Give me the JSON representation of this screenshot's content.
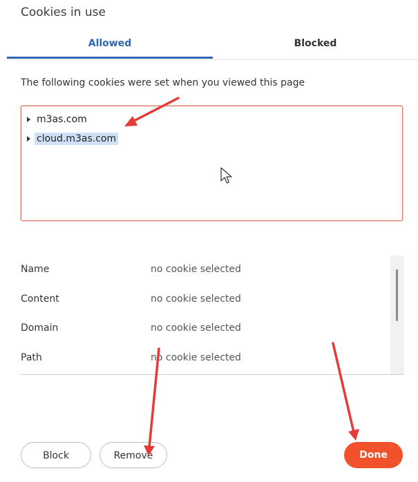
{
  "dialog": {
    "title": "Cookies in use"
  },
  "tabs": [
    {
      "label": "Allowed"
    },
    {
      "label": "Blocked"
    }
  ],
  "description": "The following cookies were set when you viewed this page",
  "tree": {
    "items": [
      {
        "label": "m3as.com"
      },
      {
        "label": "cloud.m3as.com"
      }
    ]
  },
  "details": {
    "rows": [
      {
        "key": "Name",
        "value": "no cookie selected"
      },
      {
        "key": "Content",
        "value": "no cookie selected"
      },
      {
        "key": "Domain",
        "value": "no cookie selected"
      },
      {
        "key": "Path",
        "value": "no cookie selected"
      }
    ]
  },
  "buttons": {
    "block": "Block",
    "remove": "Remove",
    "done": "Done"
  },
  "colors": {
    "accent": "#2f67b4",
    "done": "#f1522c",
    "annotation": "#e53a3a",
    "selection": "#cfe0f7"
  },
  "icons": [
    "expand-triangle-icon",
    "mouse-pointer-icon",
    "annotation-arrow"
  ]
}
